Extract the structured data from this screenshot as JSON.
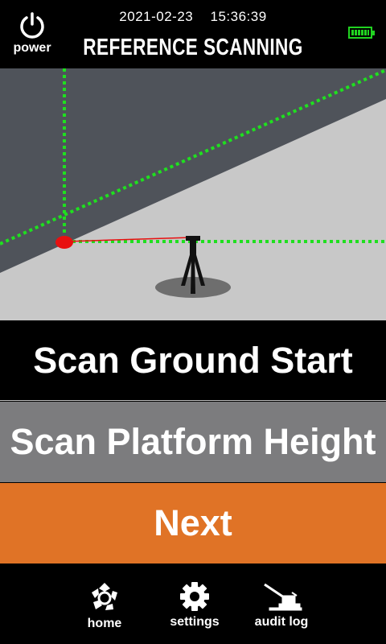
{
  "header": {
    "power_label": "power",
    "date": "2021-02-23",
    "time": "15:36:39",
    "title": "REFERENCE SCANNING",
    "battery_level": 1.0,
    "battery_color": "#21d321"
  },
  "scene": {
    "ground_color": "#c8c8c8",
    "wall_color": "#4f535a",
    "guide_color": "#1fe01f",
    "marker_color": "#e81010"
  },
  "buttons": {
    "scan_ground_start": "Scan Ground Start",
    "scan_platform_height": "Scan Platform Height",
    "next": "Next",
    "next_color": "#e07326"
  },
  "nav": {
    "home": "home",
    "settings": "settings",
    "audit_log": "audit log"
  }
}
